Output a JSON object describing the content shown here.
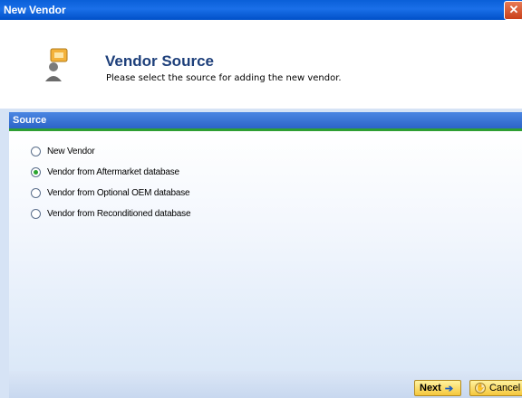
{
  "window": {
    "title": "New Vendor",
    "close_glyph": "✕"
  },
  "header": {
    "title": "Vendor Source",
    "subtitle": "Please select the source for adding the new vendor.",
    "icon": "vendor-icon"
  },
  "section": {
    "label": "Source"
  },
  "options": [
    {
      "label": "New Vendor",
      "checked": false
    },
    {
      "label": "Vendor from Aftermarket database",
      "checked": true
    },
    {
      "label": "Vendor from Optional OEM database",
      "checked": false
    },
    {
      "label": "Vendor from Reconditioned database",
      "checked": false
    }
  ],
  "footer": {
    "next_label": "Next",
    "cancel_label": "Cancel"
  },
  "colors": {
    "title_bar": "#0a5fd8",
    "section_bar": "#2c64c8",
    "accent_green": "#2e9e33",
    "button": "#f5c73c"
  }
}
